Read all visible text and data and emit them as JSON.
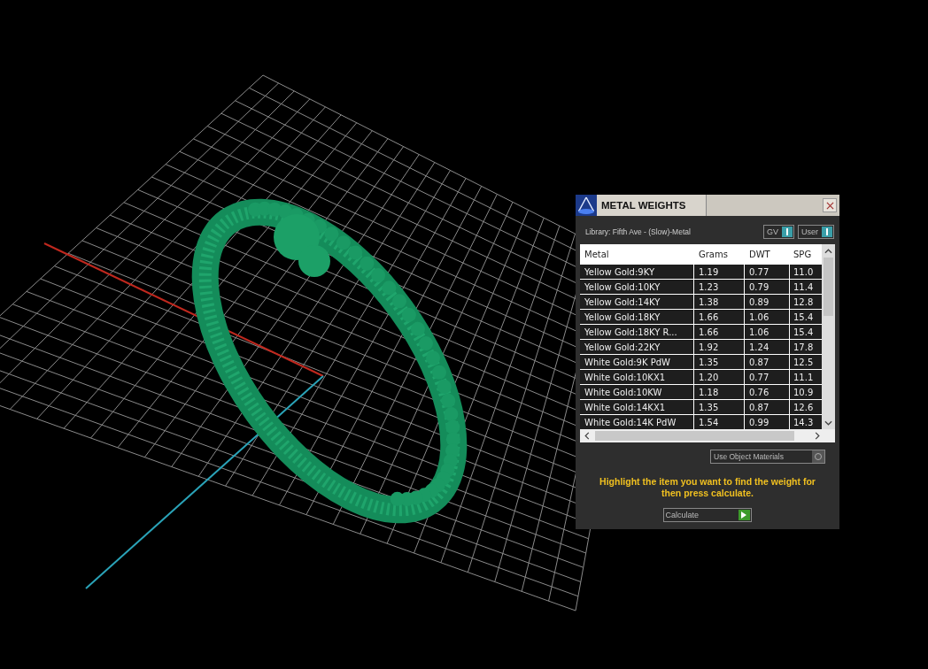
{
  "window": {
    "title": "METAL WEIGHTS"
  },
  "library": "Library: Fifth Ave - (Slow)-Metal",
  "toggles": [
    {
      "label": "GV",
      "on": true
    },
    {
      "label": "User",
      "on": true
    }
  ],
  "table": {
    "columns": [
      "Metal",
      "Grams",
      "DWT",
      "SPG"
    ],
    "rows": [
      [
        "Yellow Gold:9KY",
        "1.19",
        "0.77",
        "11.0"
      ],
      [
        "Yellow Gold:10KY",
        "1.23",
        "0.79",
        "11.4"
      ],
      [
        "Yellow Gold:14KY",
        "1.38",
        "0.89",
        "12.8"
      ],
      [
        "Yellow Gold:18KY",
        "1.66",
        "1.06",
        "15.4"
      ],
      [
        "Yellow Gold:18KY R...",
        "1.66",
        "1.06",
        "15.4"
      ],
      [
        "Yellow Gold:22KY",
        "1.92",
        "1.24",
        "17.8"
      ],
      [
        "White Gold:9K PdW",
        "1.35",
        "0.87",
        "12.5"
      ],
      [
        "White Gold:10KX1",
        "1.20",
        "0.77",
        "11.1"
      ],
      [
        "White Gold:10KW",
        "1.18",
        "0.76",
        "10.9"
      ],
      [
        "White Gold:14KX1",
        "1.35",
        "0.87",
        "12.6"
      ],
      [
        "White Gold:14K PdW",
        "1.54",
        "0.99",
        "14.3"
      ]
    ]
  },
  "use_object_materials": {
    "label": "Use Object Materials",
    "checked": false
  },
  "hint": "Highlight the item you want to find the weight for then press calculate.",
  "calculate_button": "Calculate"
}
